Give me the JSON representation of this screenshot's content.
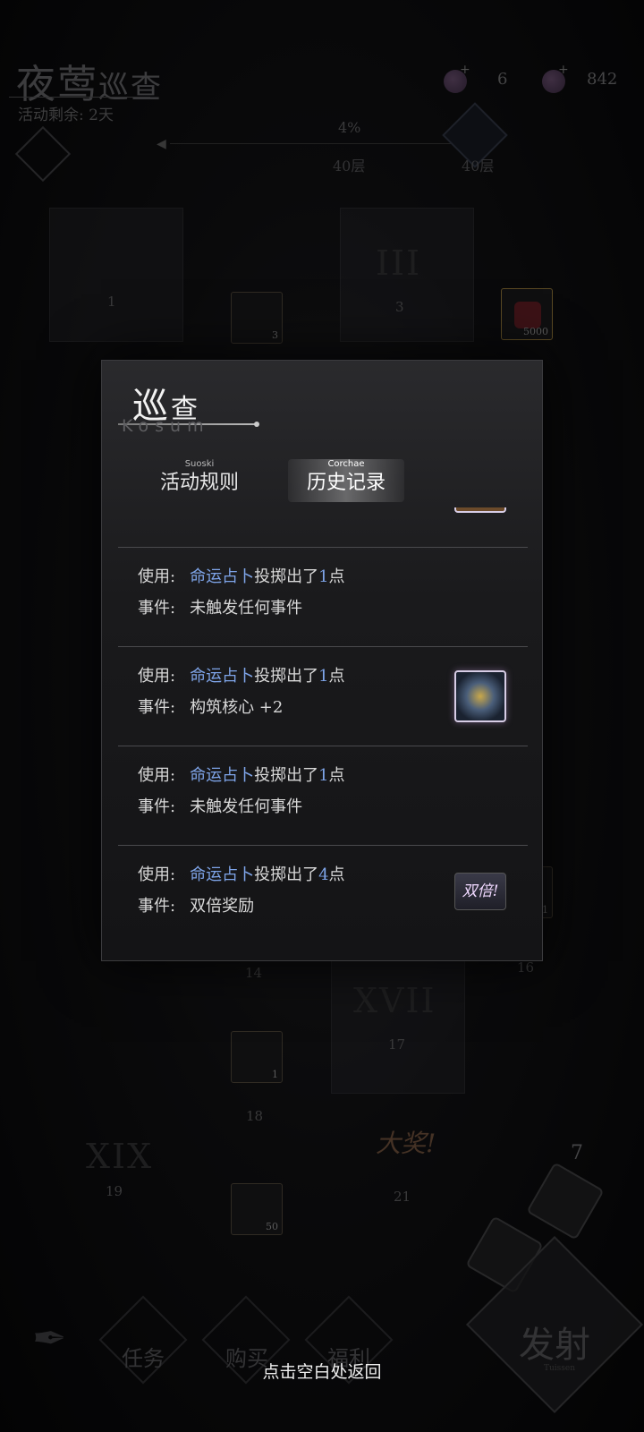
{
  "header": {
    "title_a": "夜莺",
    "title_b": "巡查",
    "remaining": "活动剩余: 2天"
  },
  "currency": {
    "item1_count": "6",
    "item2_count": "842"
  },
  "progress": {
    "percent": "4%",
    "layer_left": "40层",
    "layer_right": "40层"
  },
  "board": {
    "tiles": [
      "1",
      "III",
      "3",
      "14",
      "16",
      "XVII",
      "17",
      "18",
      "XIX",
      "19",
      "21"
    ],
    "items": [
      {
        "count": "3"
      },
      {
        "count": "5000"
      },
      {
        "count": "1"
      },
      {
        "count": "1"
      },
      {
        "count": "50"
      }
    ],
    "big_prize": "大奖!",
    "dice_count": "7"
  },
  "bottom_nav": {
    "fire": "发射",
    "fire_en": "Tuissen",
    "items": [
      "任务",
      "购买",
      "福利"
    ]
  },
  "dialog": {
    "title_a": "巡",
    "title_b": "查",
    "subtitle": "Kosum",
    "tabs": [
      {
        "en": "Suoski",
        "cn": "活动规则"
      },
      {
        "en": "Corchae",
        "cn": "历史记录"
      }
    ],
    "records": [
      {
        "use_label": "使用:",
        "use_item": "命运占卜",
        "use_text": "投掷出了",
        "points": "1",
        "unit": "点",
        "event_label": "事件:",
        "event": "未触发任何事件",
        "icon": ""
      },
      {
        "use_label": "使用:",
        "use_item": "命运占卜",
        "use_text": "投掷出了",
        "points": "1",
        "unit": "点",
        "event_label": "事件:",
        "event": "构筑核心 +2",
        "icon": "core-icon"
      },
      {
        "use_label": "使用:",
        "use_item": "命运占卜",
        "use_text": "投掷出了",
        "points": "1",
        "unit": "点",
        "event_label": "事件:",
        "event": "未触发任何事件",
        "icon": ""
      },
      {
        "use_label": "使用:",
        "use_item": "命运占卜",
        "use_text": "投掷出了",
        "points": "4",
        "unit": "点",
        "event_label": "事件:",
        "event": "双倍奖励",
        "icon": "double-icon",
        "icon_text": "双倍!"
      }
    ]
  },
  "hint": "点击空白处返回"
}
